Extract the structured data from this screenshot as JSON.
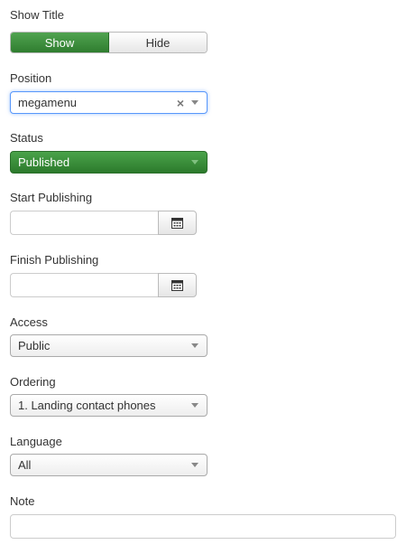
{
  "show_title": {
    "label": "Show Title",
    "options": [
      "Show",
      "Hide"
    ],
    "selected": "Show"
  },
  "position": {
    "label": "Position",
    "value": "megamenu"
  },
  "status": {
    "label": "Status",
    "value": "Published"
  },
  "start_publishing": {
    "label": "Start Publishing",
    "value": ""
  },
  "finish_publishing": {
    "label": "Finish Publishing",
    "value": ""
  },
  "access": {
    "label": "Access",
    "value": "Public"
  },
  "ordering": {
    "label": "Ordering",
    "value": "1. Landing contact phones"
  },
  "language": {
    "label": "Language",
    "value": "All"
  },
  "note": {
    "label": "Note",
    "value": ""
  },
  "icons": {
    "clear": "×",
    "calendar": "calendar-icon",
    "dropdown": "chevron-down-icon"
  },
  "colors": {
    "active_green": "#3d8f3d",
    "focus_blue": "#5897fb"
  }
}
